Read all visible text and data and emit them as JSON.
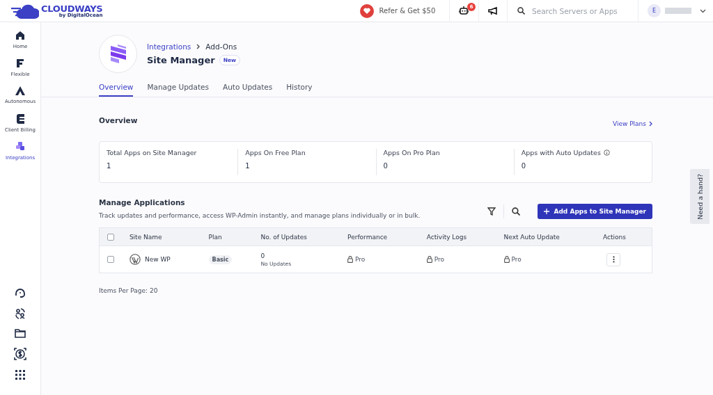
{
  "header": {
    "logo": {
      "name": "CLOUDWAYS",
      "tagline": "by DigitalOcean"
    },
    "refer": "Refer & Get $50",
    "notification_count": "6",
    "search": {
      "placeholder": "Search Servers or Apps"
    },
    "user_initial": "E"
  },
  "sidebar": {
    "items": [
      {
        "kind": "home",
        "label": "Home",
        "selected": false
      },
      {
        "kind": "flexible",
        "label": "Flexible",
        "selected": false
      },
      {
        "kind": "autonomous",
        "label": "Autonomous",
        "selected": false
      },
      {
        "kind": "billing",
        "label": "Client Billing",
        "selected": false
      },
      {
        "kind": "integrations",
        "label": "Integrations",
        "selected": true
      }
    ],
    "tools": [
      {
        "kind": "support"
      },
      {
        "kind": "team"
      },
      {
        "kind": "folder"
      },
      {
        "kind": "money"
      },
      {
        "kind": "apps"
      }
    ]
  },
  "breadcrumb": [
    {
      "label": "Integrations",
      "link": true
    },
    {
      "label": "Add-Ons",
      "link": false
    }
  ],
  "title": "Site Manager",
  "title_badge": "New",
  "tabs": [
    {
      "label": "Overview",
      "selected": true
    },
    {
      "label": "Manage Updates",
      "selected": false
    },
    {
      "label": "Auto Updates",
      "selected": false
    },
    {
      "label": "History",
      "selected": false
    }
  ],
  "overview": {
    "heading": "Overview",
    "link": "View Plans",
    "stats": [
      {
        "label": "Total Apps on Site Manager",
        "value": "1",
        "info": false
      },
      {
        "label": "Apps On Free Plan",
        "value": "1",
        "info": false
      },
      {
        "label": "Apps On Pro Plan",
        "value": "0",
        "info": false
      },
      {
        "label": "Apps with Auto Updates",
        "value": "0",
        "info": true
      }
    ]
  },
  "applications": {
    "heading": "Manage Applications",
    "description": "Track updates and performance, access WP-Admin instantly, and manage plans individually or in bulk.",
    "add_button": "Add Apps to Site Manager",
    "table": {
      "select_all": false,
      "columns": [
        "Site Name",
        "Plan",
        "No. of Updates",
        "Performance",
        "Activity Logs",
        "Next Auto Update",
        "Actions"
      ],
      "rows": [
        {
          "checked": false,
          "site_name": "New WP",
          "plan": "Basic",
          "updates": "0",
          "updates_note": "No Updates",
          "performance": "Pro",
          "activity_logs": "Pro",
          "next_auto_update": "Pro"
        }
      ]
    },
    "items_per_page": "Items Per Page: 20"
  },
  "help_tab": "Need a hand?"
}
